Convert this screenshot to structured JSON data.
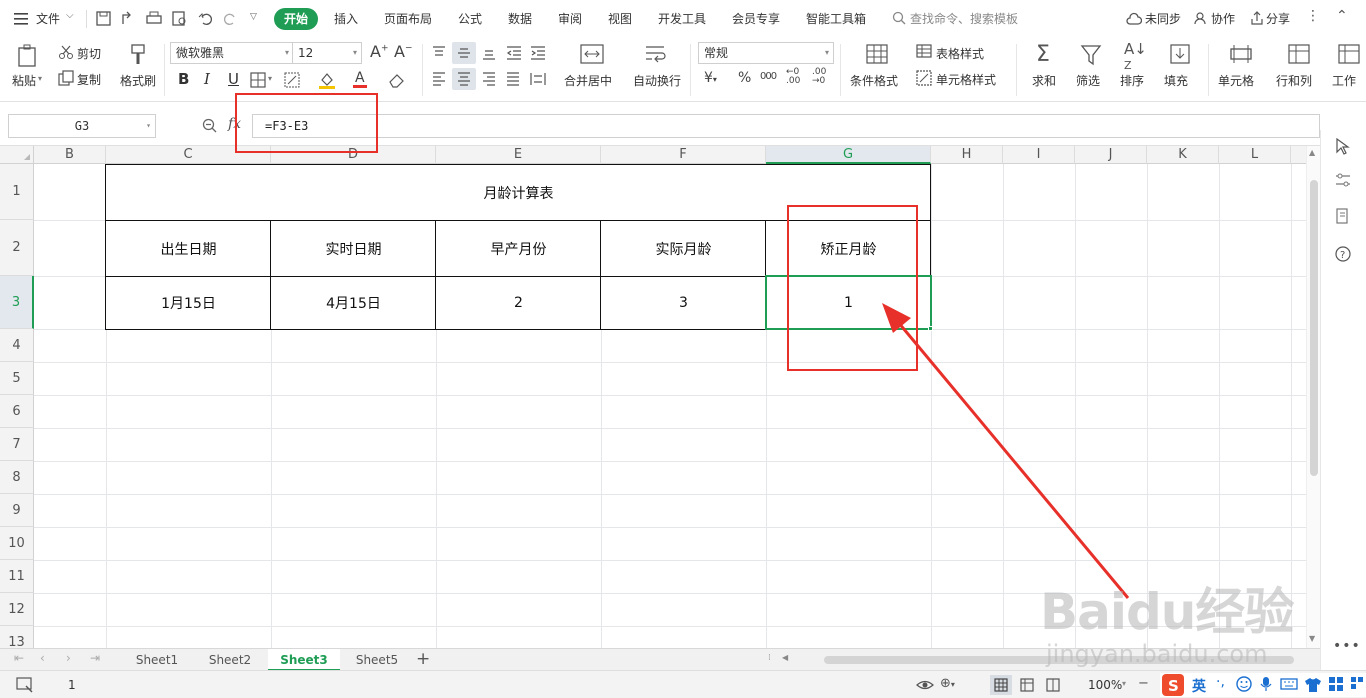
{
  "titlebar": {
    "menu_label": "文件",
    "tabs": [
      "开始",
      "插入",
      "页面布局",
      "公式",
      "数据",
      "审阅",
      "视图",
      "开发工具",
      "会员专享",
      "智能工具箱"
    ],
    "search_placeholder": "查找命令、搜索模板",
    "sync_label": "未同步",
    "collab_label": "协作",
    "share_label": "分享"
  },
  "ribbon": {
    "paste": "粘贴",
    "cut": "剪切",
    "copy": "复制",
    "format_painter": "格式刷",
    "font_name": "微软雅黑",
    "font_size": "12",
    "merge_center": "合并居中",
    "wrap_text": "自动换行",
    "number_format": "常规",
    "conditional_format": "条件格式",
    "table_style": "表格样式",
    "cell_style": "单元格样式",
    "sum": "求和",
    "filter": "筛选",
    "sort": "排序",
    "fill": "填充",
    "cell": "单元格",
    "row_col": "行和列",
    "worksheet": "工作"
  },
  "formula_bar": {
    "name_box": "G3",
    "fx": "fx",
    "formula": "=F3-E3"
  },
  "grid": {
    "columns": [
      "B",
      "C",
      "D",
      "E",
      "F",
      "G",
      "H",
      "I",
      "J",
      "K",
      "L"
    ],
    "rows": [
      "1",
      "2",
      "3",
      "4",
      "5",
      "6",
      "7",
      "8",
      "9",
      "10",
      "11",
      "12",
      "13"
    ],
    "title": "月龄计算表",
    "headers": [
      "出生日期",
      "实时日期",
      "早产月份",
      "实际月龄",
      "矫正月龄"
    ],
    "values": [
      "1月15日",
      "4月15日",
      "2",
      "3",
      "1"
    ]
  },
  "sheets": [
    "Sheet1",
    "Sheet2",
    "Sheet3",
    "Sheet5"
  ],
  "status": {
    "value": "1",
    "zoom": "100%",
    "ime": "英"
  },
  "watermark": {
    "text": "Baidu经验",
    "url": "jingyan.baidu.com"
  },
  "colors": {
    "accent": "#1f9d55",
    "annotation": "#e8302a"
  }
}
